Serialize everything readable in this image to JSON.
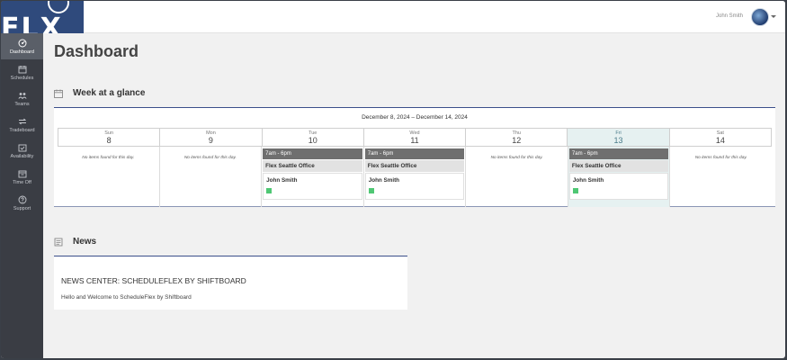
{
  "logo": {
    "text": "FLX"
  },
  "header": {
    "user_name": "John Smith"
  },
  "sidebar": {
    "items": [
      {
        "label": "Dashboard",
        "icon": "dashboard-icon",
        "active": true
      },
      {
        "label": "Schedules",
        "icon": "calendar-icon"
      },
      {
        "label": "Teams",
        "icon": "team-icon"
      },
      {
        "label": "Tradeboard",
        "icon": "swap-icon"
      },
      {
        "label": "Availability",
        "icon": "availability-icon"
      },
      {
        "label": "Time Off",
        "icon": "time-off-icon"
      },
      {
        "label": "Support",
        "icon": "help-icon"
      }
    ]
  },
  "main": {
    "title": "Dashboard"
  },
  "week": {
    "section_title": "Week at a glance",
    "date_range": "December 8, 2024 – December 14, 2024",
    "empty_text": "No items found for this day.",
    "days": [
      {
        "name": "Sun",
        "num": "8"
      },
      {
        "name": "Mon",
        "num": "9"
      },
      {
        "name": "Tue",
        "num": "10",
        "shift": {
          "time": "7am - 6pm",
          "location": "Flex Seattle Office",
          "person": "John Smith"
        }
      },
      {
        "name": "Wed",
        "num": "11",
        "shift": {
          "time": "7am - 6pm",
          "location": "Flex Seattle Office",
          "person": "John Smith"
        }
      },
      {
        "name": "Thu",
        "num": "12"
      },
      {
        "name": "Fri",
        "num": "13",
        "today": true,
        "shift": {
          "time": "7am - 6pm",
          "location": "Flex Seattle Office",
          "person": "John Smith"
        }
      },
      {
        "name": "Sat",
        "num": "14"
      }
    ]
  },
  "news": {
    "section_title": "News",
    "title": "NEWS CENTER: SCHEDULEFLEX BY SHIFTBOARD",
    "text": "Hello and Welcome to ScheduleFlex by Shiftboard"
  },
  "colors": {
    "sidebar": "#3a3d44",
    "logo": "#2f4a7c",
    "accent": "#3b4f8a",
    "today": "#e6f1f1",
    "status_dot": "#4fc774"
  }
}
